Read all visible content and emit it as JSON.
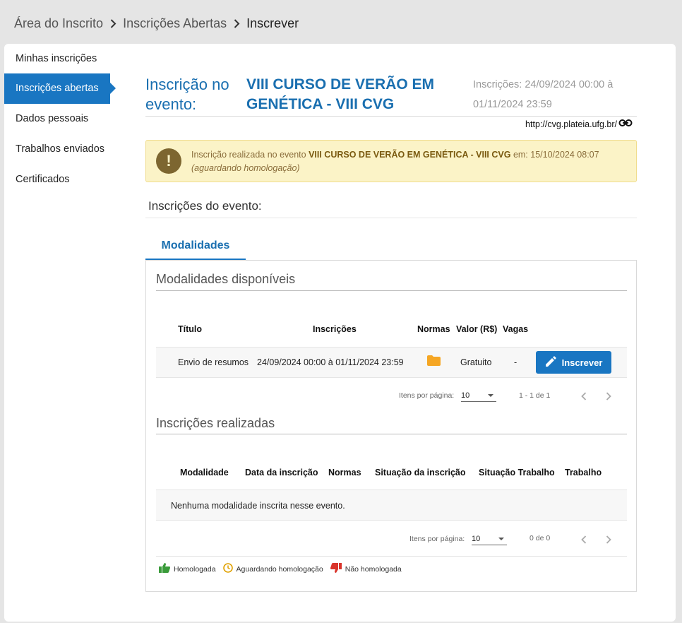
{
  "breadcrumb": {
    "items": [
      "Área do Inscrito",
      "Inscrições Abertas"
    ],
    "current": "Inscrever"
  },
  "sidebar": {
    "items": [
      {
        "label": "Minhas inscrições"
      },
      {
        "label": "Inscrições abertas"
      },
      {
        "label": "Dados pessoais"
      },
      {
        "label": "Trabalhos enviados"
      },
      {
        "label": "Certificados"
      }
    ]
  },
  "event": {
    "label": "Inscrição no evento:",
    "name": "VIII CURSO DE VERÃO EM GENÉTICA - VIII CVG",
    "period": "Inscrições: 24/09/2024 00:00 à 01/11/2024 23:59",
    "url": "http://cvg.plateia.ufg.br/"
  },
  "alert": {
    "prefix": "Inscrição realizada no evento ",
    "event_name": "VIII CURSO DE VERÃO EM GENÉTICA - VIII CVG",
    "suffix": " em: 15/10/2024 08:07",
    "status": "(aguardando homologação)"
  },
  "section_title": "Inscrições do evento:",
  "tab_label": "Modalidades",
  "available": {
    "title": "Modalidades disponíveis",
    "headers": {
      "titulo": "Título",
      "inscricoes": "Inscrições",
      "normas": "Normas",
      "valor": "Valor (R$)",
      "vagas": "Vagas"
    },
    "row": {
      "titulo": "Envio de resumos",
      "inscricoes": "24/09/2024 00:00 à 01/11/2024 23:59",
      "valor": "Gratuito",
      "vagas": "-"
    },
    "button_label": "Inscrever",
    "pager": {
      "label": "Itens por página:",
      "size": "10",
      "range": "1 - 1 de 1"
    }
  },
  "done": {
    "title": "Inscrições realizadas",
    "headers": {
      "modalidade": "Modalidade",
      "data": "Data da inscrição",
      "normas": "Normas",
      "situacao": "Situação da inscrição",
      "situacao_trabalho": "Situação Trabalho",
      "trabalho": "Trabalho"
    },
    "empty": "Nenhuma modalidade inscrita nesse evento.",
    "pager": {
      "label": "Itens por página:",
      "size": "10",
      "range": "0 de 0"
    }
  },
  "legend": {
    "approved": "Homologada",
    "pending": "Aguardando homologação",
    "rejected": "Não homologada"
  },
  "colors": {
    "primary": "#1976c2",
    "folder": "#f5a623",
    "approved": "#3a9b3a",
    "pending": "#e0a100",
    "rejected": "#d9342b"
  }
}
